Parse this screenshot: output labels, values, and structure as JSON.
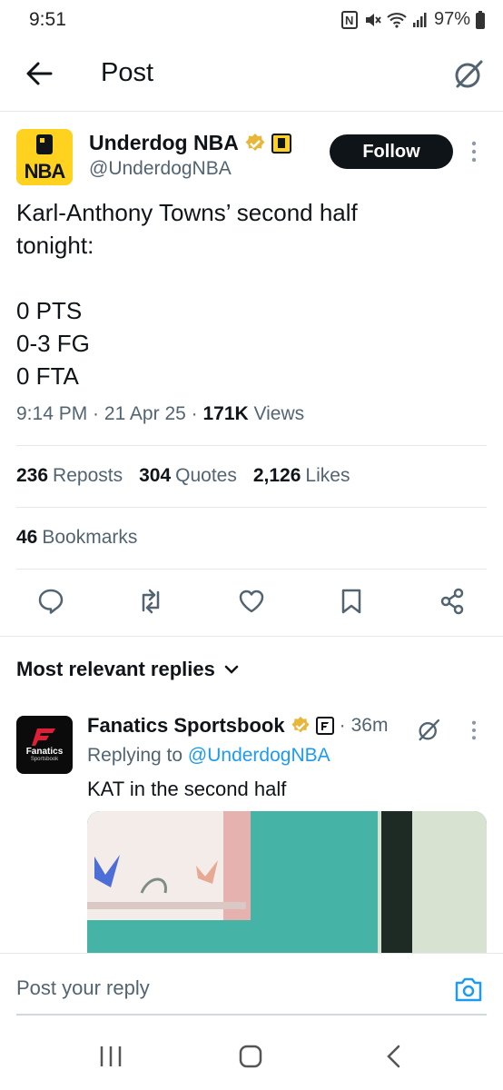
{
  "status_bar": {
    "time": "9:51",
    "battery": "97%"
  },
  "header": {
    "title": "Post"
  },
  "author": {
    "name": "Underdog NBA",
    "handle": "@UnderdogNBA",
    "avatar_text": "NBA"
  },
  "follow": {
    "label": "Follow"
  },
  "tweet": {
    "text": "Karl-Anthony Towns’ second half\ntonight:\n\n0 PTS\n0-3 FG\n0 FTA",
    "time": "9:14 PM",
    "date": "21 Apr 25",
    "views_count": "171K",
    "views_label": "Views"
  },
  "stats": {
    "reposts_count": "236",
    "reposts_label": "Reposts",
    "quotes_count": "304",
    "quotes_label": "Quotes",
    "likes_count": "2,126",
    "likes_label": "Likes",
    "bookmarks_count": "46",
    "bookmarks_label": "Bookmarks"
  },
  "replies_sort": {
    "label": "Most relevant replies"
  },
  "reply": {
    "name": "Fanatics Sportsbook",
    "time": "36m",
    "replying_prefix": "Replying to",
    "replying_handle": "@UnderdogNBA",
    "text": "KAT in the second half",
    "avatar_text_1": "Fanatics",
    "avatar_text_2": "Sportsbook"
  },
  "composer": {
    "placeholder": "Post your reply"
  },
  "colors": {
    "accent": "#1d9bf0",
    "brand_yellow": "#ffd21f",
    "verified_gold": "#e8b73a"
  }
}
